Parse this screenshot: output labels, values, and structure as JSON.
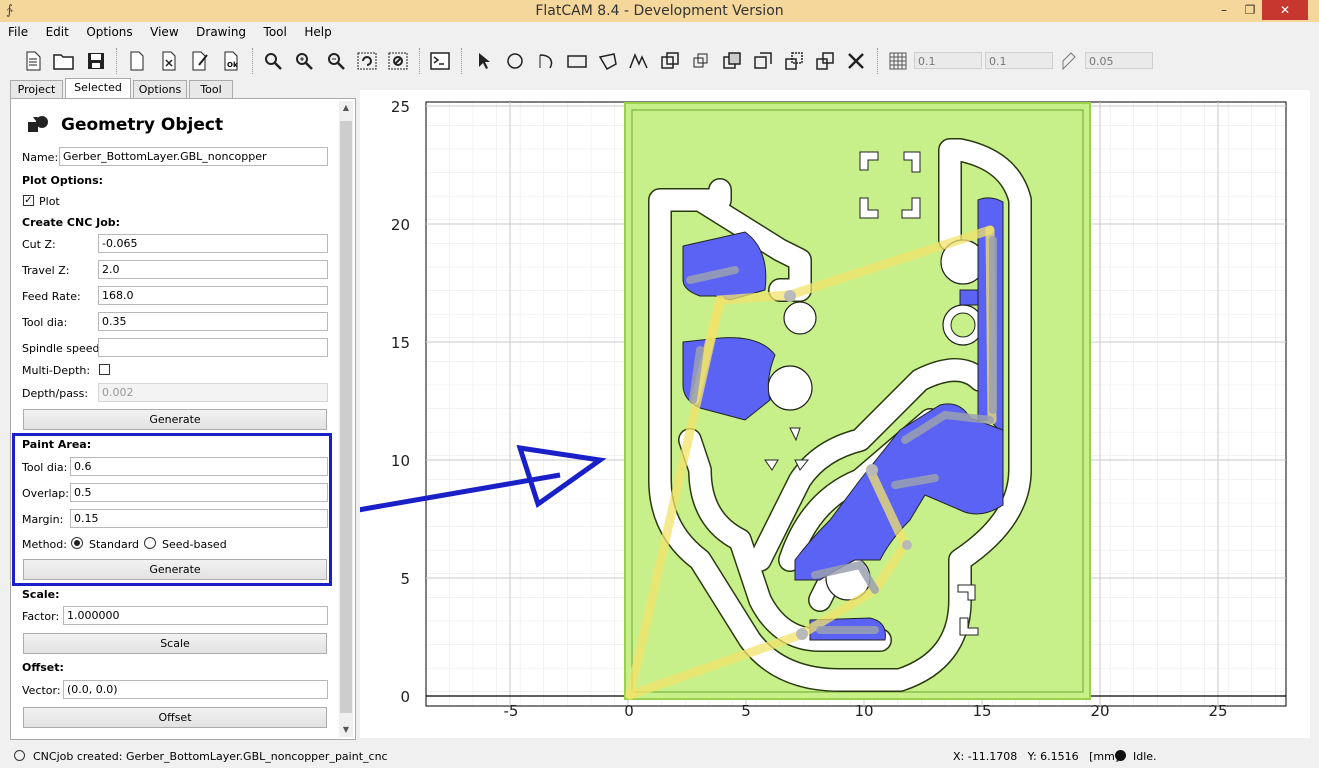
{
  "window": {
    "title": "FlatCAM 8.4 - Development Version",
    "app_icon": "flatcam-logo-icon",
    "titlebar_color": "#f5d69b"
  },
  "menu": [
    "File",
    "Edit",
    "Options",
    "View",
    "Drawing",
    "Tool",
    "Help"
  ],
  "toolbar": {
    "grid_x": "0.1",
    "grid_y": "0.1",
    "snap_max": "0.05"
  },
  "tabs": [
    "Project",
    "Selected",
    "Options",
    "Tool"
  ],
  "selected_tab": "Selected",
  "panel": {
    "header": "Geometry Object",
    "name_label": "Name:",
    "name_value": "Gerber_BottomLayer.GBL_noncopper",
    "plot_options": "Plot Options:",
    "plot_label": "Plot",
    "create_cnc": "Create CNC Job:",
    "cut_z_label": "Cut Z:",
    "cut_z": "-0.065",
    "travel_z_label": "Travel Z:",
    "travel_z": "2.0",
    "feed_rate_label": "Feed Rate:",
    "feed_rate": "168.0",
    "tool_dia_label": "Tool dia:",
    "tool_dia": "0.35",
    "spindle_label": "Spindle speed:",
    "spindle": "",
    "multidepth_label": "Multi-Depth:",
    "depth_label": "Depth/pass:",
    "depth": "0.002",
    "generate_label": "Generate",
    "paint_area": "Paint Area:",
    "paint_tool_dia_label": "Tool dia:",
    "paint_tool_dia": "0.6",
    "overlap_label": "Overlap:",
    "overlap": "0.5",
    "margin_label": "Margin:",
    "margin": "0.15",
    "method_label": "Method:",
    "method_standard": "Standard",
    "method_seed": "Seed-based",
    "paint_generate_label": "Generate",
    "scale_title": "Scale:",
    "factor_label": "Factor:",
    "factor": "1.000000",
    "scale_button": "Scale",
    "offset_title": "Offset:",
    "vector_label": "Vector:",
    "vector": "(0.0, 0.0)",
    "offset_button": "Offset"
  },
  "plot": {
    "x_ticks": [
      "-5",
      "0",
      "5",
      "10",
      "15",
      "20",
      "25"
    ],
    "y_ticks": [
      "25",
      "20",
      "15",
      "10",
      "5",
      "0"
    ],
    "fill_color": "#c8f08a",
    "paint_color": "#5b63f5",
    "annotation_color": "#1a20c8"
  },
  "status": {
    "message": "CNCjob created: Gerber_BottomLayer.GBL_noncopper_paint_cnc",
    "coords": "X: -11.1708   Y: 6.1516   [mm]",
    "state": "Idle."
  }
}
